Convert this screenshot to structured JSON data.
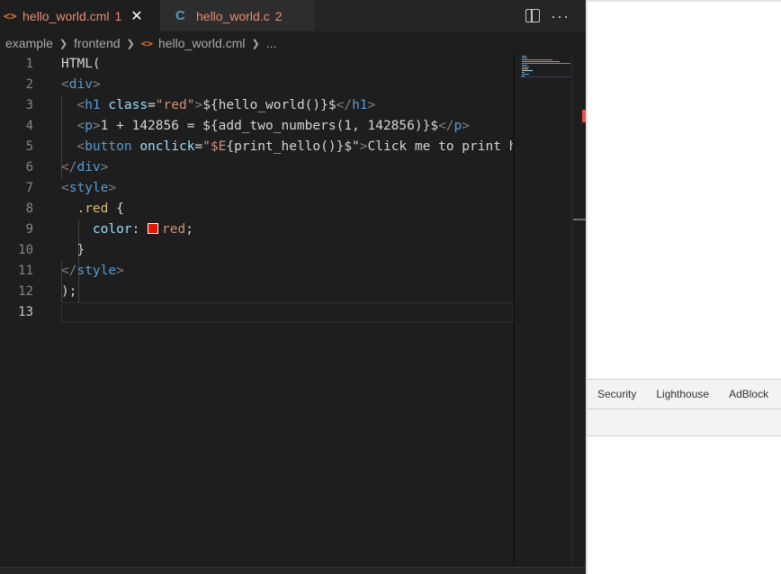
{
  "tabs": [
    {
      "name": "hello_world.cml",
      "badge": "1",
      "icon": "html-icon",
      "close": "✕"
    },
    {
      "name": "hello_world.c",
      "badge": "2",
      "icon": "c-icon"
    }
  ],
  "breadcrumb": [
    "example",
    "frontend",
    "hello_world.cml",
    "..."
  ],
  "code_lines": [
    {
      "n": "1"
    },
    {
      "n": "2"
    },
    {
      "n": "3"
    },
    {
      "n": "4"
    },
    {
      "n": "5"
    },
    {
      "n": "6"
    },
    {
      "n": "7"
    },
    {
      "n": "8"
    },
    {
      "n": "9"
    },
    {
      "n": "10"
    },
    {
      "n": "11"
    },
    {
      "n": "12"
    },
    {
      "n": "13"
    }
  ],
  "code": {
    "l1": "HTML(",
    "l3_tag": "h1",
    "l3_attr": "class",
    "l3_val": "\"red\"",
    "l3_text": "${hello_world()}$",
    "l4_tag": "p",
    "l4_text": "1 + 142856 = ${add_two_numbers(1, 142856)}$",
    "l5_tag": "button",
    "l5_attr": "onclick",
    "l5_val_a": "\"$E",
    "l5_val_b": "{print_hello()}$\"",
    "l5_text": "Click me to print hello",
    "l6_tag": "div",
    "l2_tag": "div",
    "l7_tag": "style",
    "l8_sel": ".red",
    "l8_brace": "{",
    "l9_prop": "color",
    "l9_val": "red",
    "l10_brace": "}",
    "l11_tag": "style",
    "l12": ");",
    "swatch_color": "#e51400"
  },
  "devtools": {
    "tabs": [
      "Security",
      "Lighthouse",
      "AdBlock"
    ]
  },
  "colors": {
    "accent_tab_text": "#e58d71",
    "html_icon": "#e37933",
    "c_icon": "#519aba",
    "error_marker": "#f14c4c"
  }
}
